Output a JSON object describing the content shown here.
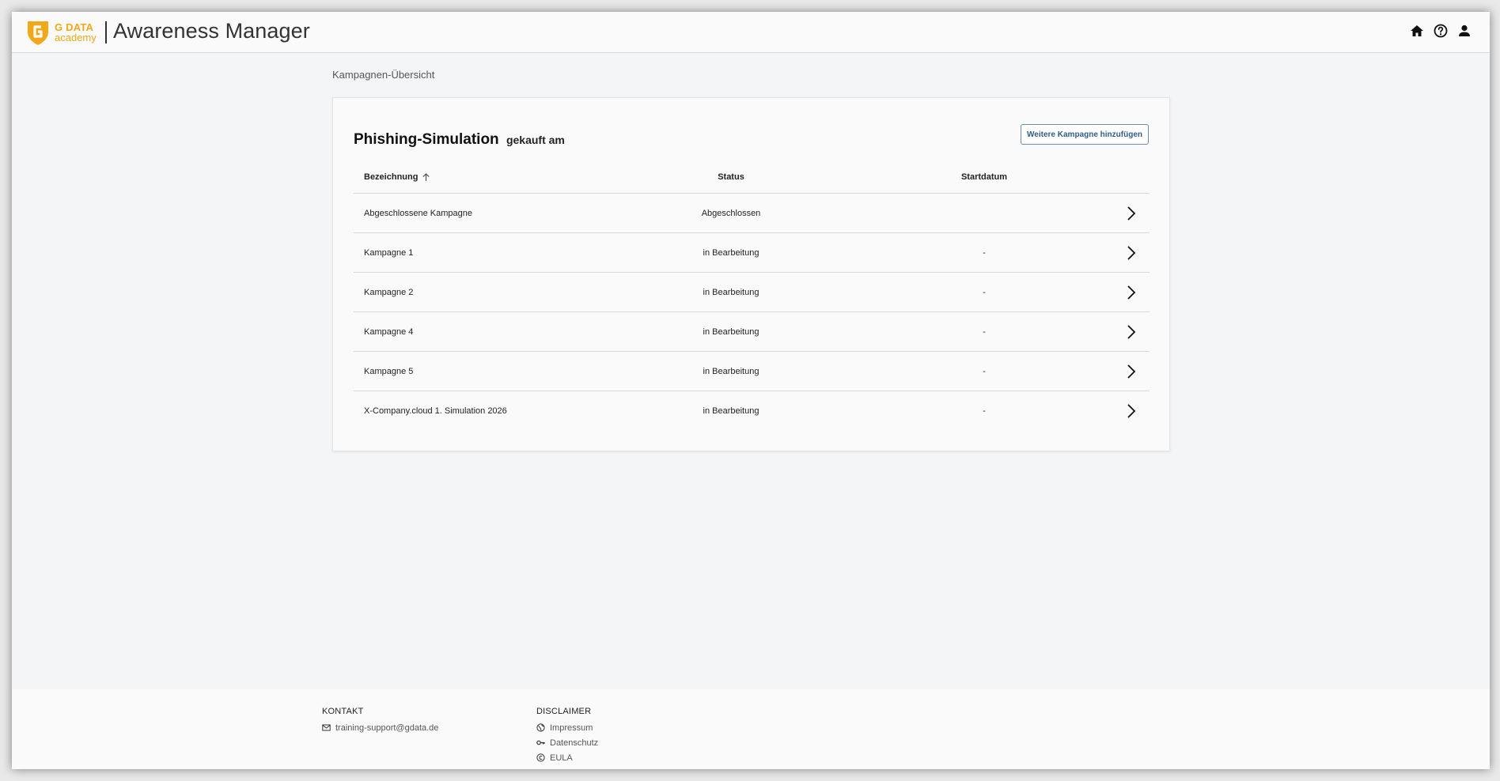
{
  "header": {
    "brand": "G DATA",
    "brand_sub": "academy",
    "app_title": "Awareness Manager",
    "colors": {
      "brand": "#f0a818",
      "text": "#333333"
    },
    "icons": [
      "home-icon",
      "help-icon",
      "user-icon"
    ]
  },
  "breadcrumb": "Kampagnen-Übersicht",
  "card": {
    "title": "Phishing-Simulation",
    "title_suffix": "gekauft am",
    "add_button": "Weitere Kampagne hinzufügen",
    "columns": {
      "name": "Bezeichnung",
      "status": "Status",
      "start": "Startdatum"
    },
    "rows": [
      {
        "name": "Abgeschlossene Kampagne",
        "status": "Abgeschlossen",
        "start": ""
      },
      {
        "name": "Kampagne 1",
        "status": "in Bearbeitung",
        "start": "-"
      },
      {
        "name": "Kampagne 2",
        "status": "in Bearbeitung",
        "start": "-"
      },
      {
        "name": "Kampagne 4",
        "status": "in Bearbeitung",
        "start": "-"
      },
      {
        "name": "Kampagne 5",
        "status": "in Bearbeitung",
        "start": "-"
      },
      {
        "name": "X-Company.cloud 1. Simulation 2026",
        "status": "in Bearbeitung",
        "start": "-"
      }
    ]
  },
  "footer": {
    "contact_title": "KONTAKT",
    "email": "training-support@gdata.de",
    "disclaimer_title": "DISCLAIMER",
    "impressum": "Impressum",
    "datenschutz": "Datenschutz",
    "eula": "EULA"
  }
}
